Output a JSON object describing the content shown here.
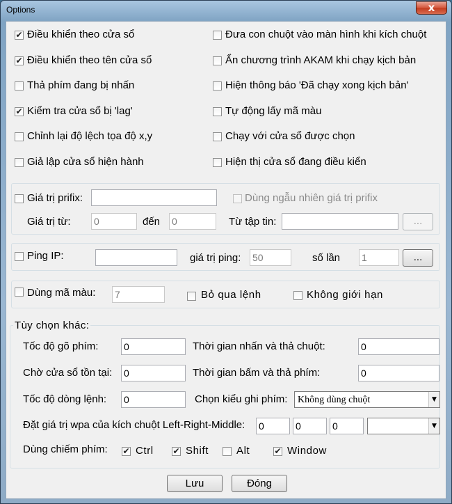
{
  "window": {
    "title": "Options",
    "close_glyph": "x"
  },
  "check_glyph": "✔",
  "left_options": [
    {
      "label": "Điều khiển theo cửa sổ",
      "checked": true
    },
    {
      "label": "Điều khiển theo tên cửa sổ",
      "checked": true
    },
    {
      "label": "Thả phím đang bị nhấn",
      "checked": false
    },
    {
      "label": "Kiểm tra cửa sổ bị 'lag'",
      "checked": true
    },
    {
      "label": "Chỉnh lại độ lệch tọa độ x,y",
      "checked": false
    },
    {
      "label": "Giả lập cửa sổ hiện hành",
      "checked": false
    }
  ],
  "right_options": [
    {
      "label": "Đưa con chuột vào màn hình khi kích chuột",
      "checked": false
    },
    {
      "label": "Ẩn chương trình AKAM khi chạy kịch bản",
      "checked": false
    },
    {
      "label": "Hiện thông báo 'Đã chạy xong kịch bản'",
      "checked": false
    },
    {
      "label": "Tự động lấy mã màu",
      "checked": false
    },
    {
      "label": "Chạy với cửa sổ được chọn",
      "checked": false
    },
    {
      "label": "Hiện thị cửa sổ đang điều kiển",
      "checked": false
    }
  ],
  "prefix": {
    "label": "Giá trị prifix:",
    "value": "",
    "random_label": "Dùng ngẫu nhiên giá trị prifix",
    "from_label": "Giá trị từ:",
    "from_value": "0",
    "to_label": "đến",
    "to_value": "0",
    "file_label": "Từ tập tin:",
    "file_value": "",
    "browse_label": "..."
  },
  "ping": {
    "label": "Ping IP:",
    "ip_value": "",
    "ping_value_label": "giá trị ping:",
    "ping_value": "50",
    "times_label": "số lần",
    "times_value": "1",
    "browse_label": "..."
  },
  "color": {
    "label": "Dùng mã màu:",
    "value": "7",
    "skip_label": "Bỏ qua lệnh",
    "unlimited_label": "Không giới hạn"
  },
  "other": {
    "title": "Tùy chọn khác:",
    "typing_speed_label": "Tốc độ gõ phím:",
    "typing_speed": "0",
    "mouse_press_label": "Thời gian nhấn và thả chuột:",
    "mouse_press": "0",
    "wait_window_label": "Chờ cửa sổ tồn tại:",
    "wait_window": "0",
    "key_press_label": "Thời gian bấm và thả phím:",
    "key_press": "0",
    "line_speed_label": "Tốc độ dòng lệnh:",
    "line_speed": "0",
    "record_mode_label": "Chọn kiểu ghi phím:",
    "record_mode_value": "Không dùng chuột",
    "wpa_label": "Đặt giá trị wpa của kích chuột Left-Right-Middle:",
    "wpa_left": "0",
    "wpa_right": "0",
    "wpa_middle": "0",
    "wpa_select_value": "",
    "hotkey_label": "Dùng chiếm phím:",
    "hotkeys": [
      {
        "label": "Ctrl",
        "checked": true
      },
      {
        "label": "Shift",
        "checked": true
      },
      {
        "label": "Alt",
        "checked": false
      },
      {
        "label": "Window",
        "checked": true
      }
    ]
  },
  "actions": {
    "save_label": "Lưu",
    "close_label": "Đóng"
  }
}
